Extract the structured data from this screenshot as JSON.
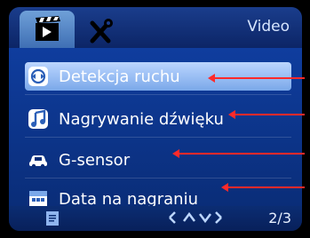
{
  "header": {
    "title": "Video",
    "tabs": [
      {
        "name": "video",
        "icon": "clapperboard-icon"
      },
      {
        "name": "settings",
        "icon": "tools-icon"
      }
    ]
  },
  "menu": {
    "items": [
      {
        "label": "Detekcja ruchu",
        "icon": "motion-detection-icon"
      },
      {
        "label": "Nagrywanie dźwięku",
        "icon": "music-note-icon"
      },
      {
        "label": "G-sensor",
        "icon": "car-icon"
      },
      {
        "label": "Data na nagraniu",
        "icon": "calendar-icon"
      }
    ],
    "selected_index": 0
  },
  "footer": {
    "page": "2/3",
    "nav": "up-down-arrows"
  },
  "colors": {
    "annotation_arrows": "#ff2a2a",
    "selected_row": "#9cc3ff"
  }
}
